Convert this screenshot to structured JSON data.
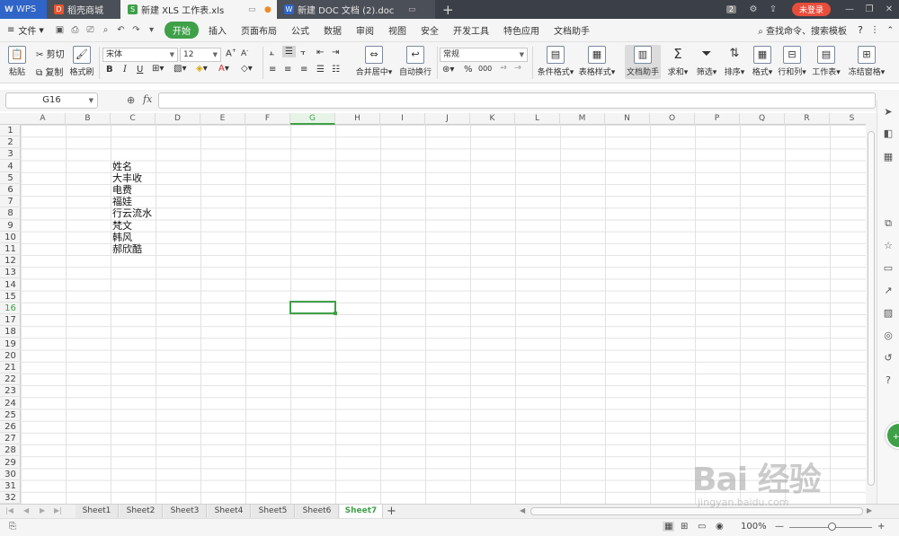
{
  "tabs": {
    "wps": "WPS",
    "mall": "稻壳商城",
    "xls": "新建 XLS 工作表.xls",
    "doc": "新建 DOC 文档 (2).doc",
    "add": "+"
  },
  "window": {
    "badge": "2",
    "login": "未登录"
  },
  "menu": {
    "file": "文件",
    "items": [
      "开始",
      "插入",
      "页面布局",
      "公式",
      "数据",
      "审阅",
      "视图",
      "安全",
      "开发工具",
      "特色应用",
      "文档助手"
    ],
    "search": "查找命令、搜索模板",
    "help": "?"
  },
  "ribbon": {
    "paste": "粘贴",
    "cut": "剪切",
    "copy": "复制",
    "format_painter": "格式刷",
    "font_name": "宋体",
    "font_size": "12",
    "bold": "B",
    "italic": "I",
    "underline": "U",
    "merge_center": "合并居中",
    "wrap": "自动换行",
    "number_format": "常规",
    "percent": "%",
    "thousands": "000",
    "cond_format": "条件格式",
    "table_style": "表格样式",
    "doc_helper": "文档助手",
    "sum": "求和",
    "filter": "筛选",
    "sort": "排序",
    "format": "格式",
    "row_col": "行和列",
    "worksheet": "工作表",
    "freeze": "冻结窗格"
  },
  "formula": {
    "cell_ref": "G16",
    "fx": "fx",
    "value": ""
  },
  "grid": {
    "columns": [
      "A",
      "B",
      "C",
      "D",
      "E",
      "F",
      "G",
      "H",
      "I",
      "J",
      "K",
      "L",
      "M",
      "N",
      "O",
      "P",
      "Q",
      "R",
      "S"
    ],
    "active_column": "G",
    "rows": [
      "1",
      "2",
      "3",
      "4",
      "5",
      "6",
      "7",
      "8",
      "9",
      "10",
      "11",
      "12",
      "13",
      "14",
      "15",
      "16",
      "17",
      "18",
      "19",
      "20",
      "21",
      "22",
      "23",
      "24",
      "25",
      "26",
      "27",
      "28",
      "29",
      "30",
      "31",
      "32"
    ],
    "active_row": "16",
    "column_c_values": [
      {
        "row": "4",
        "text": "姓名"
      },
      {
        "row": "5",
        "text": "大丰收"
      },
      {
        "row": "6",
        "text": "电费"
      },
      {
        "row": "7",
        "text": "福娃"
      },
      {
        "row": "8",
        "text": "行云流水"
      },
      {
        "row": "9",
        "text": "梵文"
      },
      {
        "row": "10",
        "text": "韩风"
      },
      {
        "row": "11",
        "text": "郝欣酷"
      }
    ]
  },
  "sheets": {
    "names": [
      "Sheet1",
      "Sheet2",
      "Sheet3",
      "Sheet4",
      "Sheet5",
      "Sheet6",
      "Sheet7"
    ],
    "active": "Sheet7"
  },
  "status": {
    "zoom": "100%"
  },
  "watermark": {
    "main": "Bai 经验",
    "sub": "jingyan.baidu.com"
  },
  "colors": {
    "accent": "#3fa048",
    "titlebar": "#3b3f48",
    "login": "#e84d3c"
  }
}
